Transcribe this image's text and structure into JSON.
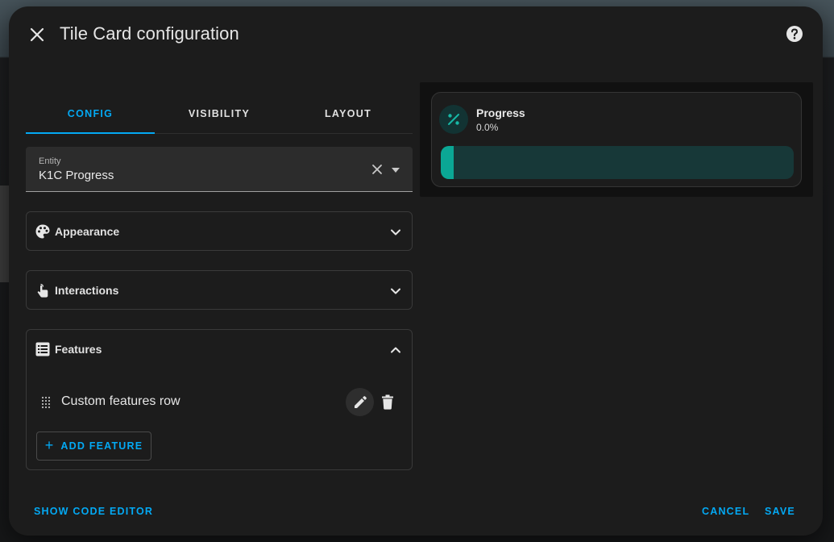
{
  "dialog": {
    "title": "Tile Card configuration"
  },
  "tabs": [
    {
      "label": "CONFIG",
      "active": true
    },
    {
      "label": "VISIBILITY",
      "active": false
    },
    {
      "label": "LAYOUT",
      "active": false
    }
  ],
  "entity": {
    "label": "Entity",
    "value": "K1C Progress"
  },
  "sections": {
    "appearance": {
      "label": "Appearance",
      "icon": "palette-icon",
      "expanded": false
    },
    "interactions": {
      "label": "Interactions",
      "icon": "gesture-tap-icon",
      "expanded": false
    },
    "features": {
      "label": "Features",
      "icon": "list-box-icon",
      "expanded": true
    }
  },
  "features": {
    "rows": [
      {
        "label": "Custom features row"
      }
    ],
    "add_label": "ADD FEATURE"
  },
  "preview": {
    "name": "Progress",
    "state": "0.0%",
    "icon": "percent-circle-icon",
    "progress": 0
  },
  "footer": {
    "code_editor": "SHOW CODE EDITOR",
    "cancel": "CANCEL",
    "save": "SAVE"
  },
  "colors": {
    "accent": "#03a9f4",
    "progress_fill": "#0ba795",
    "progress_track": "#173838"
  }
}
